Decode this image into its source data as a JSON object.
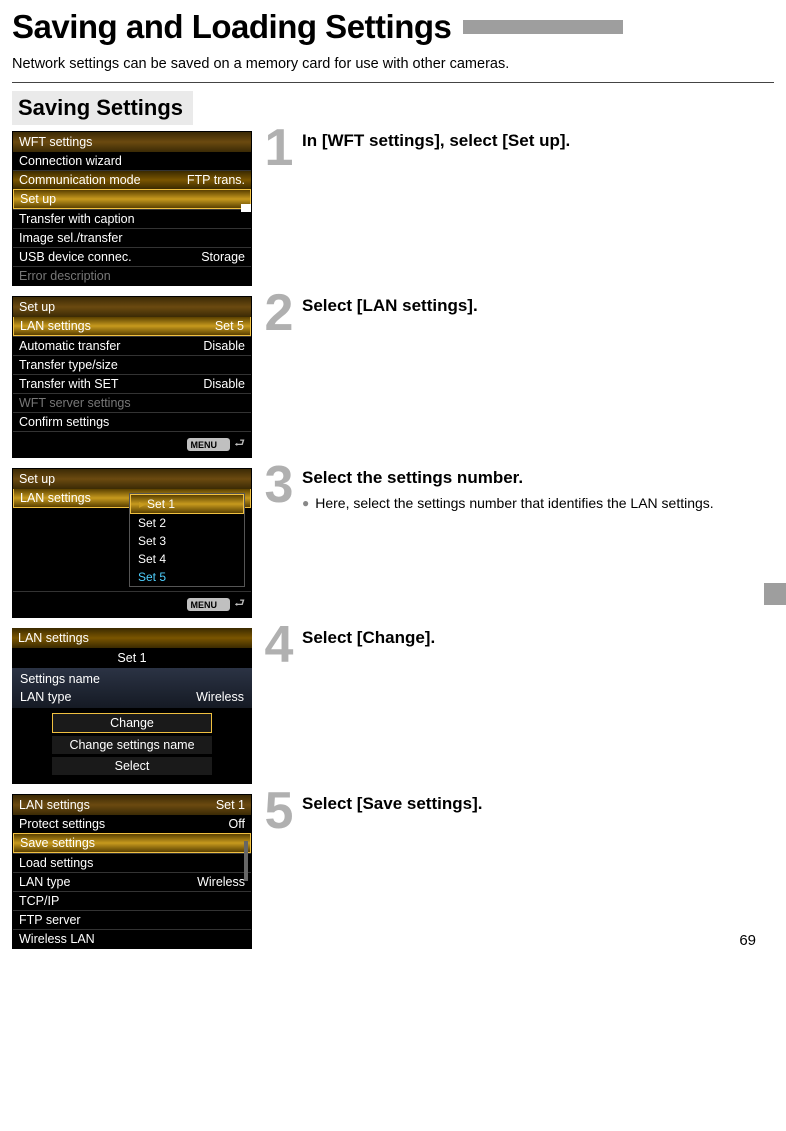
{
  "title": "Saving and Loading Settings",
  "intro": "Network settings can be saved on a memory card for use with other cameras.",
  "section_header": "Saving Settings",
  "page_number": "69",
  "steps": [
    {
      "num": "1",
      "title": "In [WFT settings], select [Set up]."
    },
    {
      "num": "2",
      "title": "Select [LAN settings]."
    },
    {
      "num": "3",
      "title": "Select the settings number.",
      "bullets": [
        "Here, select the settings number that identifies the LAN settings."
      ]
    },
    {
      "num": "4",
      "title": "Select [Change]."
    },
    {
      "num": "5",
      "title": "Select [Save settings]."
    }
  ],
  "screen1": {
    "header": "WFT settings",
    "rows": [
      {
        "lbl": "Connection wizard",
        "val": ""
      },
      {
        "lbl": "Communication mode",
        "val": "FTP trans.",
        "gold": true
      },
      {
        "lbl": "Set up",
        "val": "",
        "sel": true
      },
      {
        "lbl": "Transfer with caption",
        "val": ""
      },
      {
        "lbl": "Image sel./transfer",
        "val": ""
      },
      {
        "lbl": "USB device connec.",
        "val": "Storage"
      },
      {
        "lbl": "Error description",
        "val": "",
        "dim": true
      }
    ]
  },
  "screen2": {
    "header": "Set up",
    "rows": [
      {
        "lbl": "LAN settings",
        "val": "Set 5",
        "sel": true
      },
      {
        "lbl": "Automatic transfer",
        "val": "Disable"
      },
      {
        "lbl": "Transfer type/size",
        "val": ""
      },
      {
        "lbl": "Transfer with SET",
        "val": "Disable"
      },
      {
        "lbl": "WFT server settings",
        "val": "",
        "dim": true
      },
      {
        "lbl": "Confirm settings",
        "val": ""
      }
    ],
    "footer_menu": "MENU"
  },
  "screen3": {
    "header": "Set up",
    "main_label": "LAN settings",
    "popup": [
      {
        "lbl": "Set 1",
        "sel": true,
        "caret": true
      },
      {
        "lbl": "Set 2"
      },
      {
        "lbl": "Set 3"
      },
      {
        "lbl": "Set 4"
      },
      {
        "lbl": "Set 5",
        "hl": true
      }
    ],
    "footer_menu": "MENU"
  },
  "screen4": {
    "header": "LAN settings",
    "sub": "Set 1",
    "lines": [
      {
        "lbl": "Settings name",
        "val": ""
      },
      {
        "lbl": "LAN type",
        "val": "Wireless"
      }
    ],
    "buttons": [
      {
        "lbl": "Change",
        "sel": true
      },
      {
        "lbl": "Change settings name"
      },
      {
        "lbl": "Select"
      }
    ]
  },
  "screen5": {
    "header": "LAN settings",
    "header_val": "Set 1",
    "rows": [
      {
        "lbl": "Protect settings",
        "val": "Off"
      },
      {
        "lbl": "Save settings",
        "val": "",
        "sel": true
      },
      {
        "lbl": "Load settings",
        "val": ""
      },
      {
        "lbl": "LAN type",
        "val": "Wireless"
      },
      {
        "lbl": "TCP/IP",
        "val": ""
      },
      {
        "lbl": "FTP server",
        "val": ""
      },
      {
        "lbl": "Wireless LAN",
        "val": ""
      }
    ]
  }
}
